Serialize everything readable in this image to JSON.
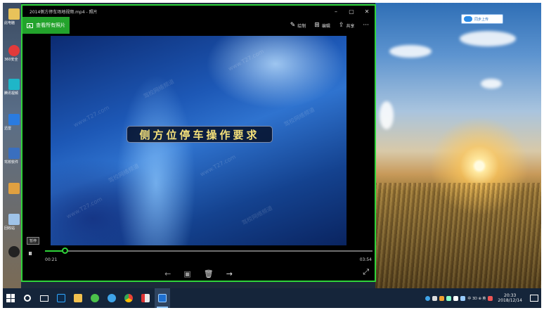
{
  "window": {
    "title": "2014侧方停车场地视频.mp4 - 照片"
  },
  "toolbar": {
    "back_label": "查看所有照片",
    "tools": [
      {
        "icon": "pen-icon",
        "label": "绘制"
      },
      {
        "icon": "edit-icon",
        "label": "编辑"
      },
      {
        "icon": "share-icon",
        "label": "共享"
      }
    ],
    "more": "···"
  },
  "video": {
    "caption": "侧方位停车操作要求",
    "watermarks": [
      "www.T27.com",
      "驾校网络频道"
    ]
  },
  "player": {
    "tooltip": "暂停",
    "current_time": "00:21",
    "total_time": "03:54",
    "progress_fraction": 0.06
  },
  "desktop": {
    "cloud_label": "同步上传",
    "icon_labels": [
      "此电脑",
      "360安全",
      "腾讯视频",
      "迅雷",
      "驾校软件",
      "回收站"
    ]
  },
  "taskbar": {
    "tray_text": "中 3D ⊕ 英",
    "time": "20:33",
    "date": "2018/12/14"
  },
  "colors": {
    "accent": "#2fd33a",
    "caption_text": "#f4e07a",
    "taskbar": "#15253a"
  }
}
